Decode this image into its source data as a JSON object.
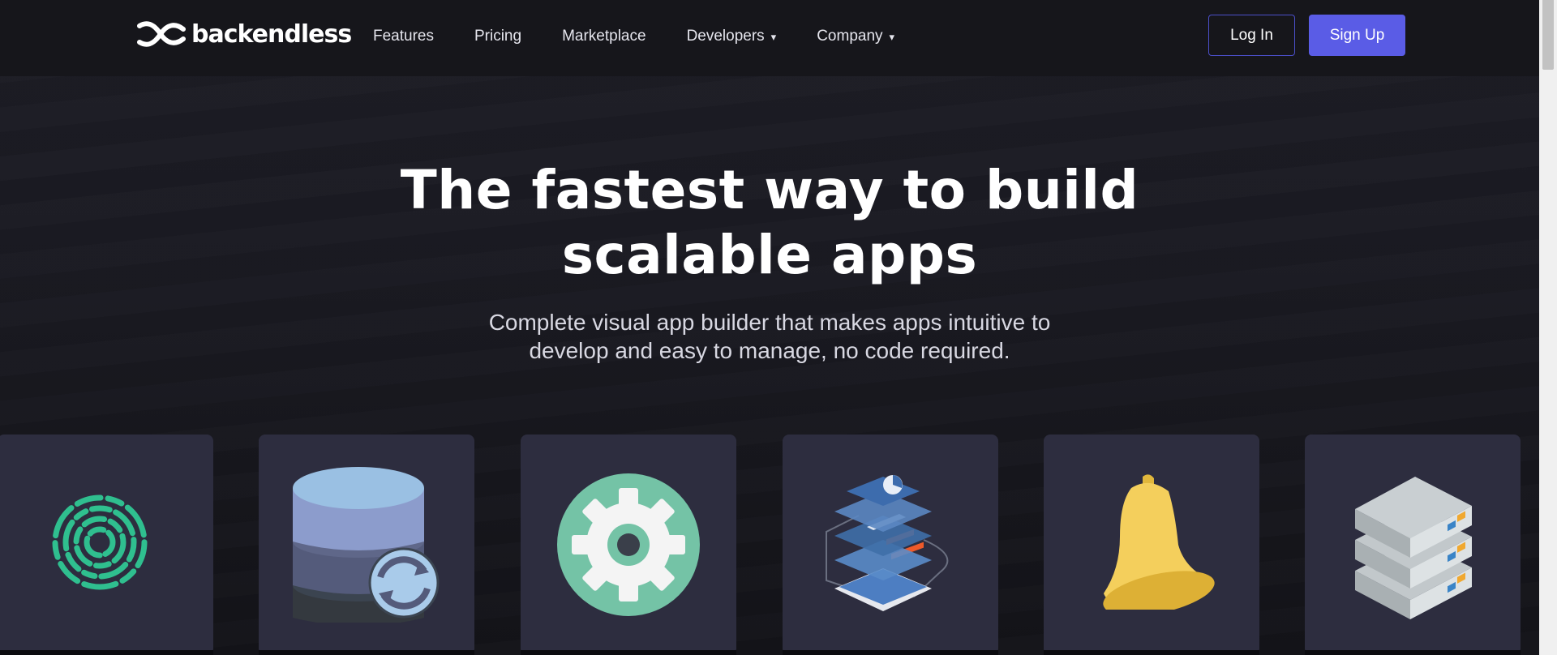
{
  "brand": {
    "name": "backendless"
  },
  "nav": [
    {
      "label": "Features",
      "dropdown": false
    },
    {
      "label": "Pricing",
      "dropdown": false
    },
    {
      "label": "Marketplace",
      "dropdown": false
    },
    {
      "label": "Developers",
      "dropdown": true
    },
    {
      "label": "Company",
      "dropdown": true
    }
  ],
  "caret": "▾",
  "auth": {
    "login_label": "Log In",
    "signup_label": "Sign Up"
  },
  "hero": {
    "title_line1": "The fastest way to build",
    "title_line2": "scalable apps",
    "subtitle_line1": "Complete visual app builder that makes apps intuitive to",
    "subtitle_line2": "develop and easy to manage, no code required."
  },
  "feature_cards": [
    {
      "icon": "fingerprint-icon",
      "color": "#2fbf8f"
    },
    {
      "icon": "database-sync-icon",
      "color": "#8fb3e0"
    },
    {
      "icon": "gear-icon",
      "color": "#74c3a6"
    },
    {
      "icon": "ui-screens-icon",
      "color": "#4a78b5"
    },
    {
      "icon": "bell-icon",
      "color": "#f4cf5c"
    },
    {
      "icon": "server-icon",
      "color": "#c9cfd2"
    }
  ],
  "colors": {
    "accent": "#5a5ce6",
    "background": "#1a1a22",
    "card": "#2d2d3f"
  }
}
